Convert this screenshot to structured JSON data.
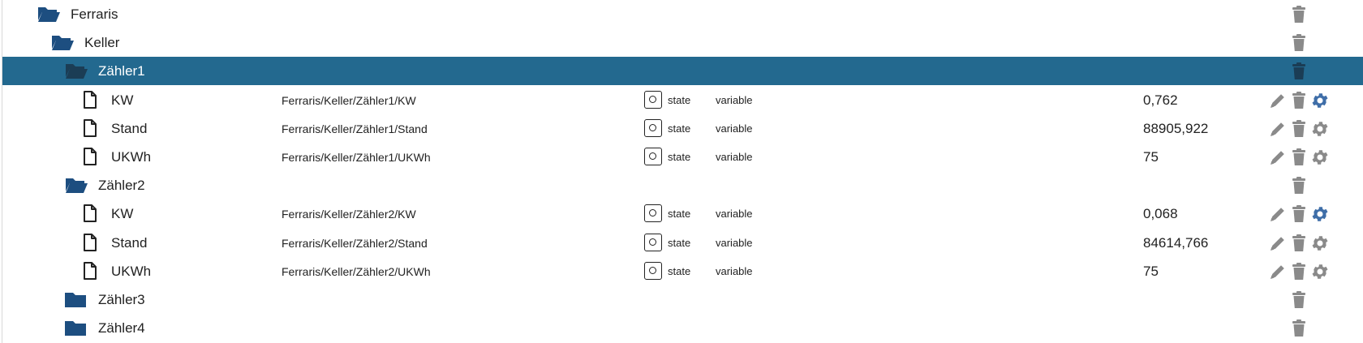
{
  "colors": {
    "folder_icon": "#1d4e80",
    "selected_row": "#23698f",
    "trash": "#8a8a8a",
    "trash_selected": "#1b3d55",
    "edit": "#8a8a8a",
    "gear_default": "#8a8a8a",
    "gear_active": "#3f6ea8"
  },
  "tree": [
    {
      "name": "Ferraris",
      "kind": "folder-open",
      "level": 0
    },
    {
      "name": "Keller",
      "kind": "folder-open",
      "level": 1
    },
    {
      "name": "Zähler1",
      "kind": "folder-open",
      "level": 2,
      "selected": true
    },
    {
      "name": "KW",
      "kind": "state",
      "level": 3,
      "path": "Ferraris/Keller/Zähler1/KW",
      "type": "state",
      "role": "variable",
      "value": "0,762",
      "gear_active": true
    },
    {
      "name": "Stand",
      "kind": "state",
      "level": 3,
      "path": "Ferraris/Keller/Zähler1/Stand",
      "type": "state",
      "role": "variable",
      "value": "88905,922",
      "gear_active": false
    },
    {
      "name": "UKWh",
      "kind": "state",
      "level": 3,
      "path": "Ferraris/Keller/Zähler1/UKWh",
      "type": "state",
      "role": "variable",
      "value": "75",
      "gear_active": false
    },
    {
      "name": "Zähler2",
      "kind": "folder-open",
      "level": 2
    },
    {
      "name": "KW",
      "kind": "state",
      "level": 3,
      "path": "Ferraris/Keller/Zähler2/KW",
      "type": "state",
      "role": "variable",
      "value": "0,068",
      "gear_active": true
    },
    {
      "name": "Stand",
      "kind": "state",
      "level": 3,
      "path": "Ferraris/Keller/Zähler2/Stand",
      "type": "state",
      "role": "variable",
      "value": "84614,766",
      "gear_active": false
    },
    {
      "name": "UKWh",
      "kind": "state",
      "level": 3,
      "path": "Ferraris/Keller/Zähler2/UKWh",
      "type": "state",
      "role": "variable",
      "value": "75",
      "gear_active": false
    },
    {
      "name": "Zähler3",
      "kind": "folder-closed",
      "level": 2
    },
    {
      "name": "Zähler4",
      "kind": "folder-closed",
      "level": 2
    }
  ]
}
